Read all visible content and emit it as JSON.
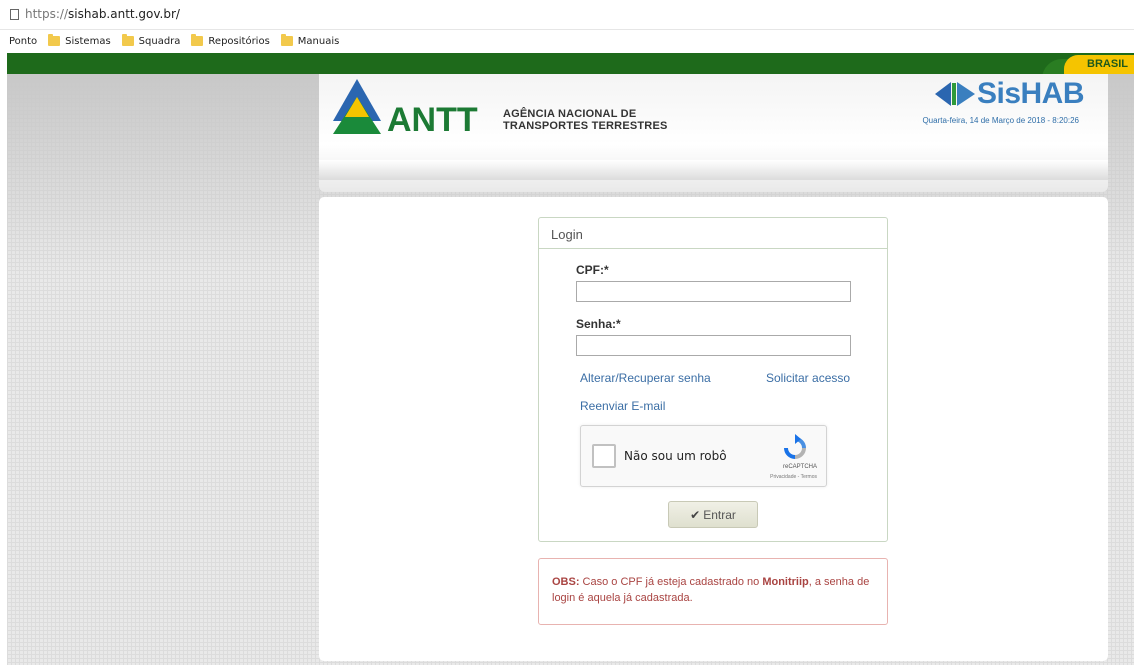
{
  "browser": {
    "url_scheme": "https://",
    "url_host": "sishab.antt.gov.br/",
    "bookmarks": [
      {
        "label": "Ponto",
        "folder": false
      },
      {
        "label": "Sistemas",
        "folder": true
      },
      {
        "label": "Squadra",
        "folder": true
      },
      {
        "label": "Repositórios",
        "folder": true
      },
      {
        "label": "Manuais",
        "folder": true
      }
    ]
  },
  "govbar": {
    "label": "BRASIL"
  },
  "header": {
    "logo_text": "ANTT",
    "agency_line1": "AGÊNCIA NACIONAL DE",
    "agency_line2": "TRANSPORTES TERRESTRES",
    "system_name": "SisHAB",
    "date": "Quarta-feira, 14 de Março de 2018 - 8:20:26"
  },
  "login": {
    "title": "Login",
    "cpf_label": "CPF:*",
    "cpf_value": "",
    "senha_label": "Senha:*",
    "senha_value": "",
    "link_recover": "Alterar/Recuperar senha",
    "link_request": "Solicitar acesso",
    "link_resend": "Reenviar E-mail",
    "recaptcha_label": "Não sou um robô",
    "recaptcha_brand": "reCAPTCHA",
    "recaptcha_terms": "Privacidade - Termos",
    "submit_label": "Entrar"
  },
  "obs": {
    "prefix": "OBS:",
    "text1": " Caso o CPF já esteja cadastrado no ",
    "highlight": "Monitriip",
    "text2": ", a senha de login é aquela já cadastrada."
  },
  "colors": {
    "gov_green": "#1e6a1b",
    "gov_yellow": "#f5c400",
    "link_blue": "#3b6ea5",
    "obs_red": "#a94442"
  }
}
